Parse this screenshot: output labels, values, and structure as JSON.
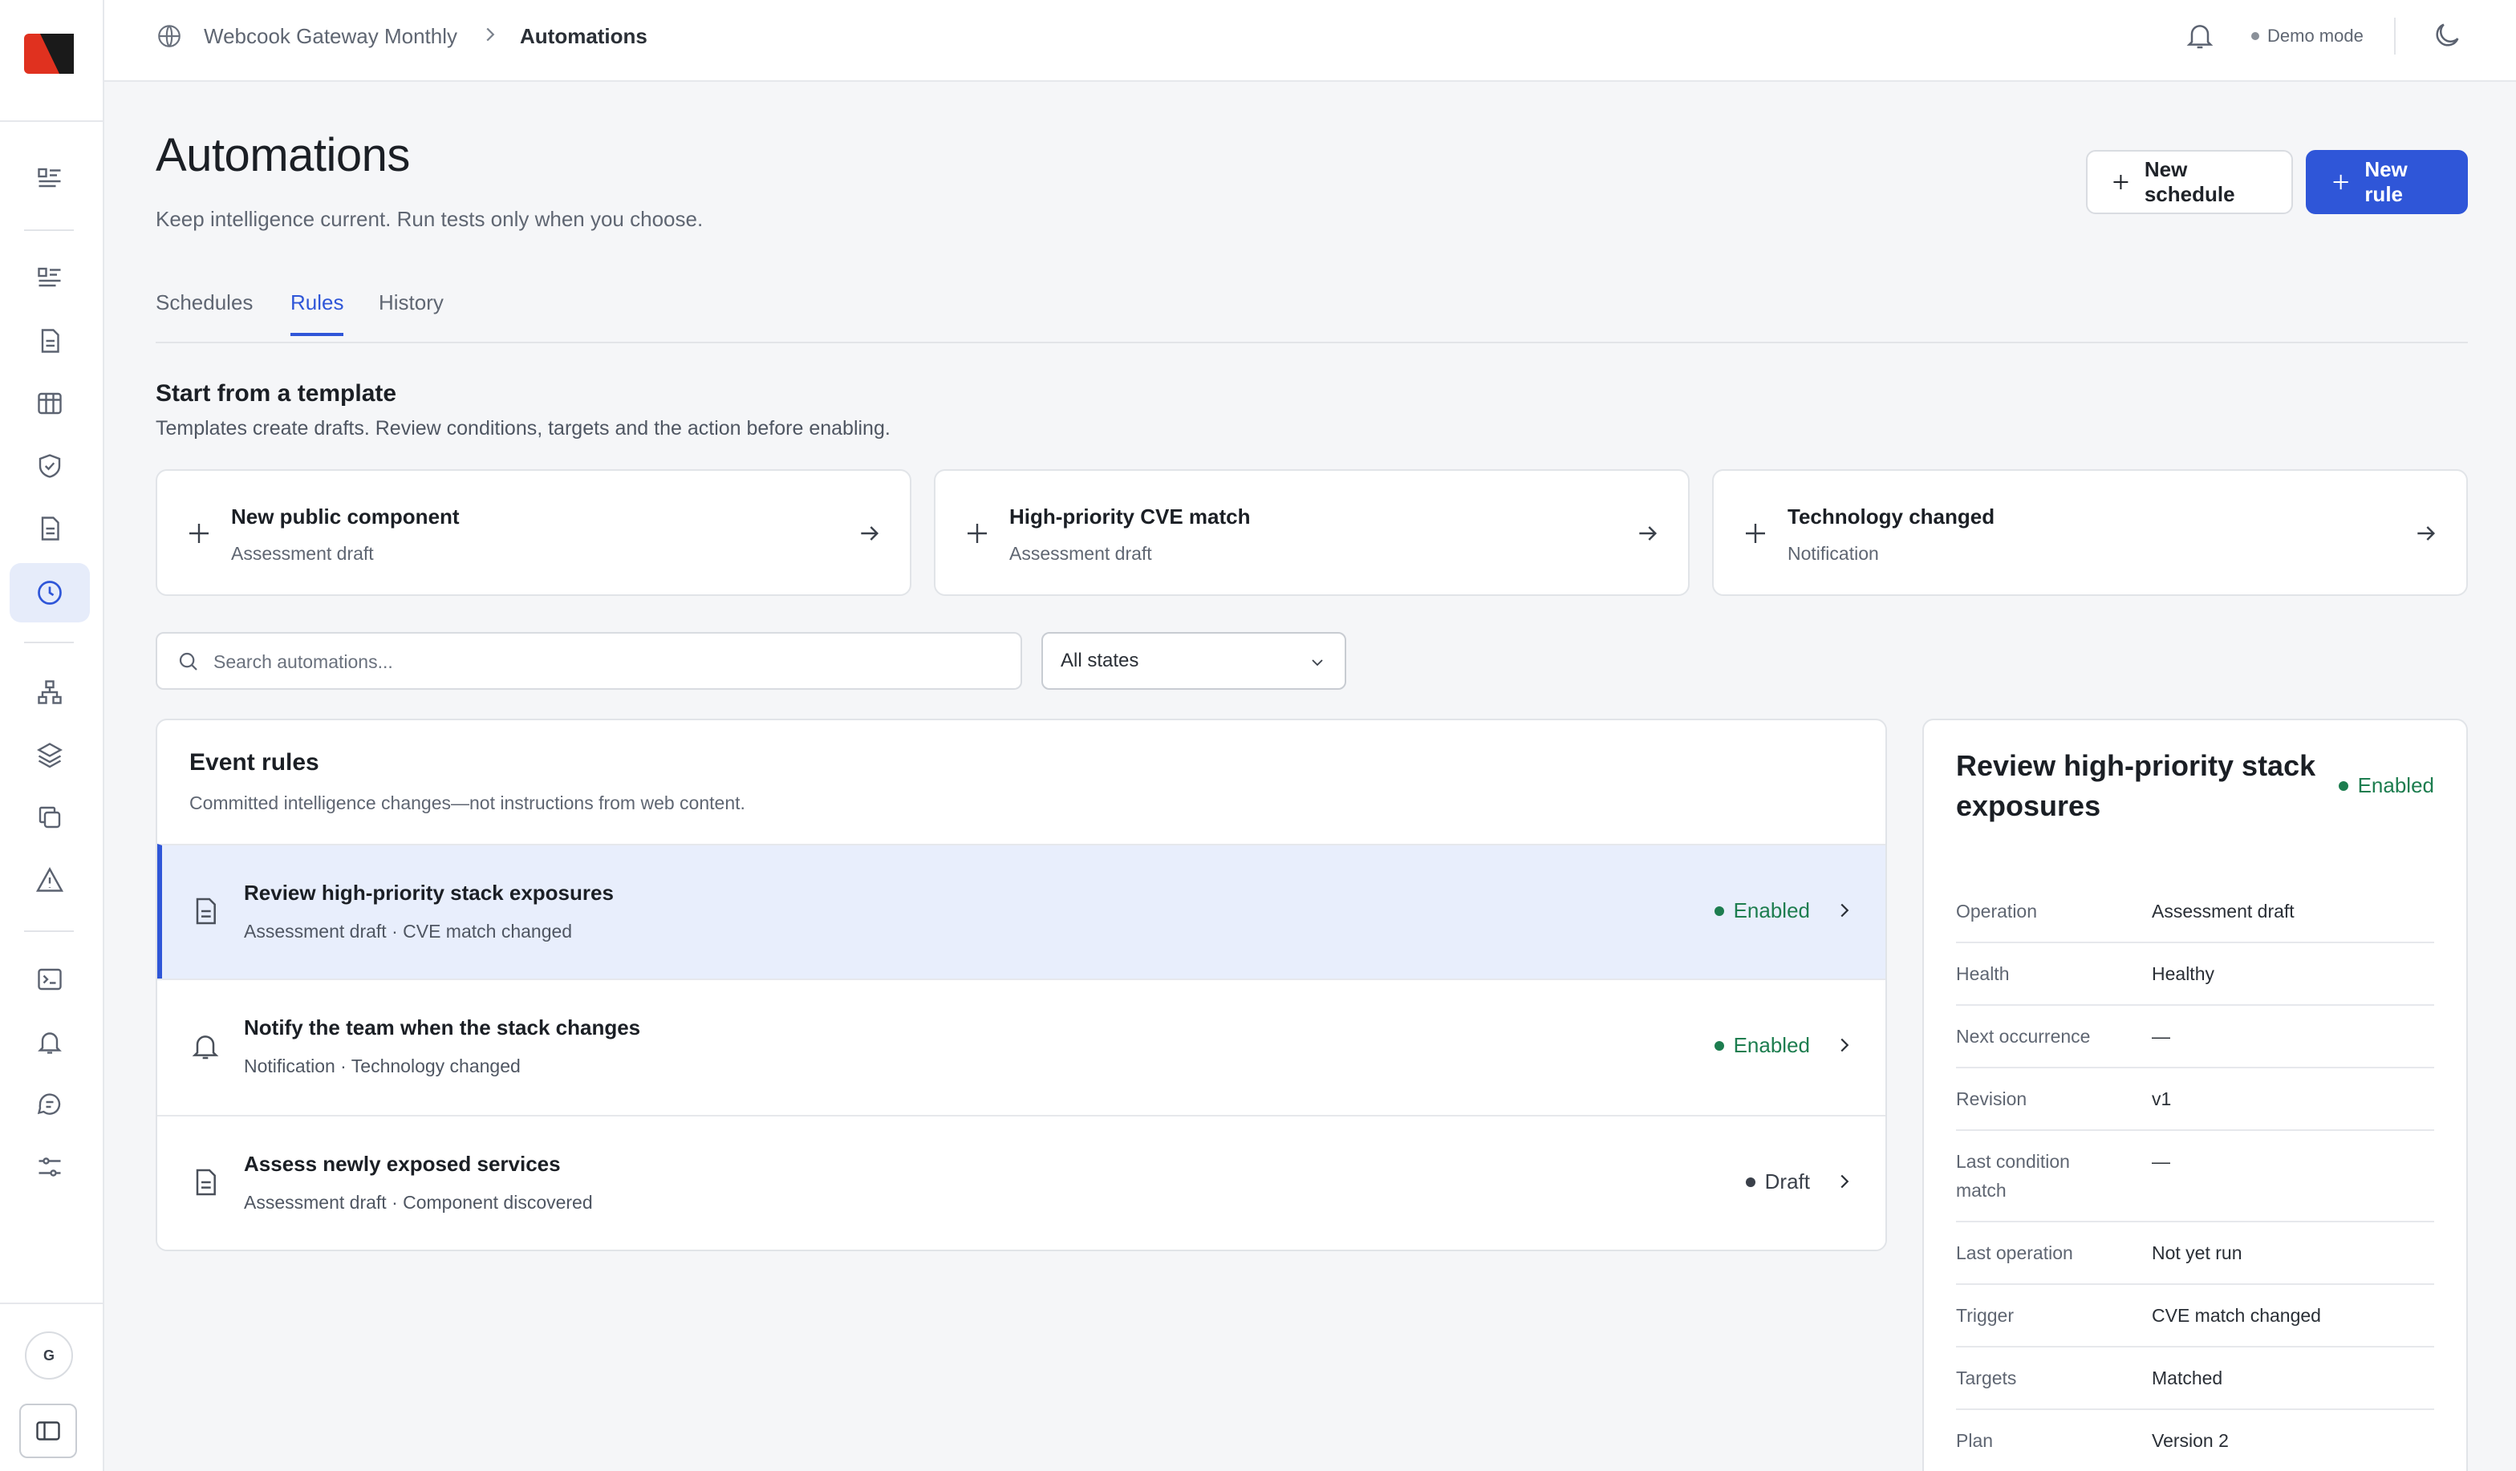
{
  "breadcrumb": {
    "workspace": "Webcook Gateway Monthly",
    "current": "Automations"
  },
  "topbar": {
    "demo_mode": "Demo mode"
  },
  "header": {
    "title": "Automations",
    "subtitle": "Keep intelligence current. Run tests only when you choose.",
    "new_schedule": "New schedule",
    "new_rule": "New rule"
  },
  "tabs": [
    {
      "label": "Schedules",
      "active": false
    },
    {
      "label": "Rules",
      "active": true
    },
    {
      "label": "History",
      "active": false
    }
  ],
  "templates": {
    "title": "Start from a template",
    "subtitle": "Templates create drafts. Review conditions, targets and the action before enabling.",
    "items": [
      {
        "title": "New public component",
        "subtitle": "Assessment draft"
      },
      {
        "title": "High-priority CVE match",
        "subtitle": "Assessment draft"
      },
      {
        "title": "Technology changed",
        "subtitle": "Notification"
      }
    ]
  },
  "search": {
    "placeholder": "Search automations..."
  },
  "filter": {
    "selected": "All states"
  },
  "rules": {
    "title": "Event rules",
    "subtitle": "Committed intelligence changes—not instructions from web content.",
    "items": [
      {
        "title": "Review high-priority stack exposures",
        "subtitle": "Assessment draft · CVE match changed",
        "status": "Enabled",
        "icon": "document-icon"
      },
      {
        "title": "Notify the team when the stack changes",
        "subtitle": "Notification · Technology changed",
        "status": "Enabled",
        "icon": "bell-icon"
      },
      {
        "title": "Assess newly exposed services",
        "subtitle": "Assessment draft · Component discovered",
        "status": "Draft",
        "icon": "document-icon"
      }
    ]
  },
  "detail": {
    "title": "Review high-priority stack exposures",
    "status": "Enabled",
    "rows": [
      {
        "key": "Operation",
        "value": "Assessment draft"
      },
      {
        "key": "Health",
        "value": "Healthy"
      },
      {
        "key": "Next occurrence",
        "value": "—"
      },
      {
        "key": "Revision",
        "value": "v1"
      },
      {
        "key": "Last condition match",
        "value": "—"
      },
      {
        "key": "Last operation",
        "value": "Not yet run"
      },
      {
        "key": "Trigger",
        "value": "CVE match changed"
      },
      {
        "key": "Targets",
        "value": "Matched"
      },
      {
        "key": "Plan",
        "value": "Version 2"
      }
    ]
  },
  "user": {
    "initial": "G"
  },
  "colors": {
    "accent": "#2f56d8",
    "enabled": "#1d7d4f",
    "selected_row": "#e8eefc",
    "logo_red": "#e0311f"
  }
}
